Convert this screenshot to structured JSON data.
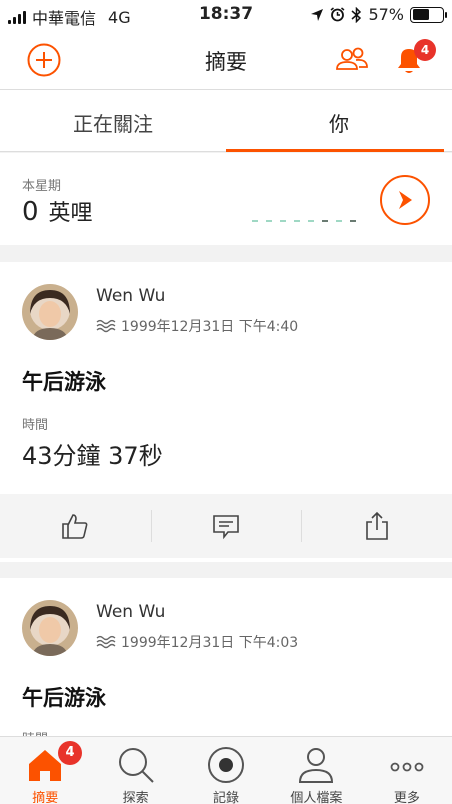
{
  "status_bar": {
    "carrier": "中華電信",
    "network": "4G",
    "time": "18:37",
    "battery_percent": "57%",
    "battery_level": 0.57
  },
  "header": {
    "title": "摘要",
    "notification_count": "4"
  },
  "tabs": [
    {
      "label": "正在關注",
      "active": false
    },
    {
      "label": "你",
      "active": true
    }
  ],
  "weekly": {
    "label": "本星期",
    "value": "0",
    "unit": "英哩"
  },
  "activities": [
    {
      "athlete": "Wen Wu",
      "datetime": "1999年12月31日 下午4:40",
      "title": "午后游泳",
      "stat_label": "時間",
      "stat_value": "43分鐘 37秒"
    },
    {
      "athlete": "Wen Wu",
      "datetime": "1999年12月31日 下午4:03",
      "title": "午后游泳",
      "stat_label": "時間"
    }
  ],
  "nav": {
    "items": [
      {
        "label": "摘要",
        "icon": "home-icon",
        "active": true
      },
      {
        "label": "探索",
        "icon": "search-icon",
        "active": false
      },
      {
        "label": "記錄",
        "icon": "record-icon",
        "active": false
      },
      {
        "label": "個人檔案",
        "icon": "profile-icon",
        "active": false
      },
      {
        "label": "更多",
        "icon": "more-icon",
        "active": false
      }
    ],
    "badge": "4"
  },
  "colors": {
    "accent": "#fc5200",
    "badge": "#e8332a"
  }
}
